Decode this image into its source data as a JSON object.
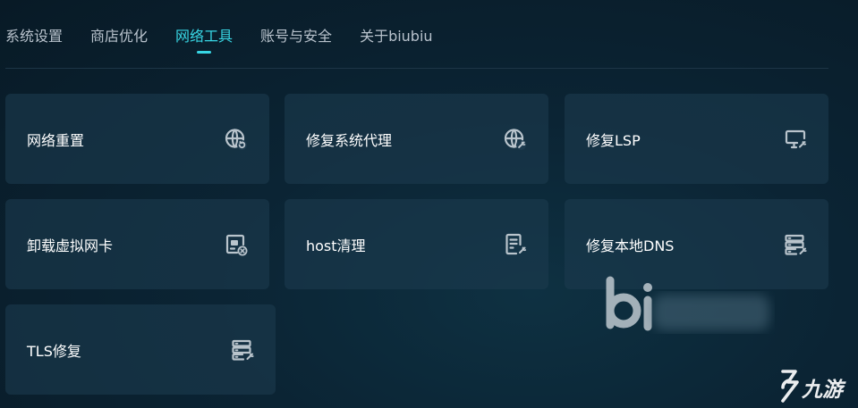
{
  "tabs": [
    {
      "label": "系统设置",
      "active": false
    },
    {
      "label": "商店优化",
      "active": false
    },
    {
      "label": "网络工具",
      "active": true
    },
    {
      "label": "账号与安全",
      "active": false
    },
    {
      "label": "关于biubiu",
      "active": false
    }
  ],
  "cards": [
    {
      "label": "网络重置",
      "icon": "globe-reset-icon"
    },
    {
      "label": "修复系统代理",
      "icon": "globe-repair-icon"
    },
    {
      "label": "修复LSP",
      "icon": "monitor-repair-icon"
    },
    {
      "label": "卸载虚拟网卡",
      "icon": "network-card-remove-icon"
    },
    {
      "label": "host清理",
      "icon": "document-clean-icon"
    },
    {
      "label": "修复本地DNS",
      "icon": "server-repair-icon"
    },
    {
      "label": "TLS修复",
      "icon": "server-repair-icon"
    }
  ],
  "watermark": {
    "logo": "biubiu",
    "corner_text": "九游"
  },
  "colors": {
    "accent": "#38d6e4",
    "card_bg": "#1c3a4e",
    "page_bg": "#0b2434",
    "icon": "#b9c4cc"
  }
}
